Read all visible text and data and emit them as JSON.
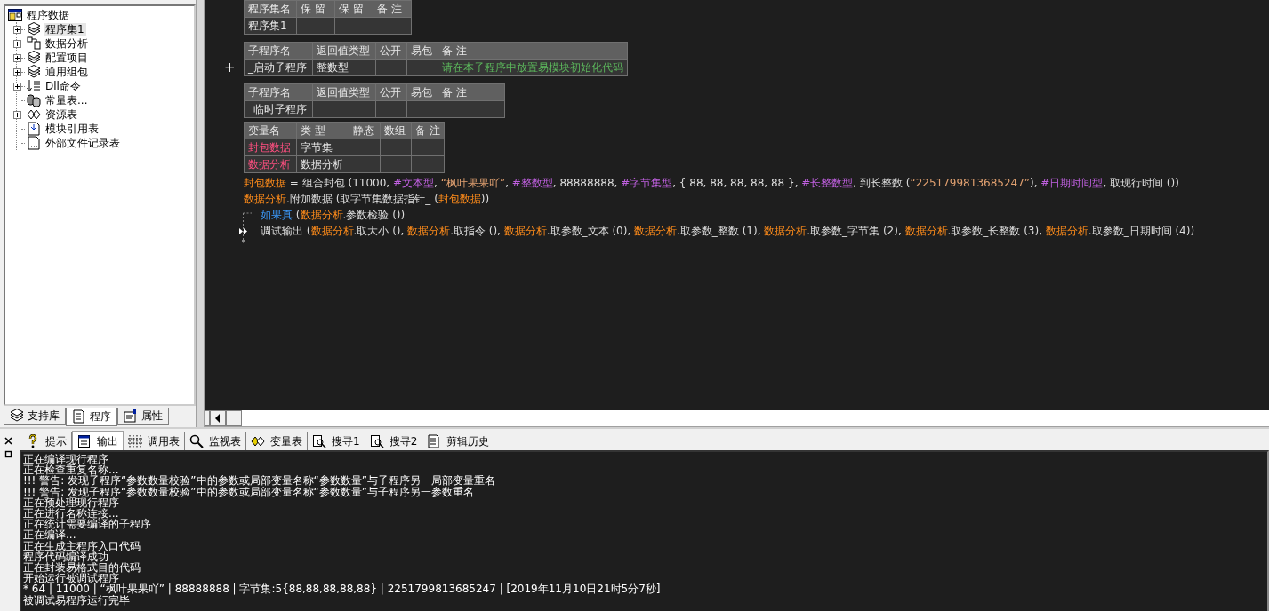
{
  "tree": {
    "root": "程序数据",
    "children": [
      {
        "label": "程序集1",
        "kind": "group",
        "selected": true
      },
      {
        "label": "数据分析",
        "kind": "group",
        "selected": false
      },
      {
        "label": "配置项目",
        "kind": "group",
        "selected": false
      },
      {
        "label": "通用组包",
        "kind": "group",
        "selected": false
      },
      {
        "label": "Dll命令",
        "kind": "group",
        "selected": false
      },
      {
        "label": "常量表...",
        "kind": "leaf",
        "selected": false
      },
      {
        "label": "资源表",
        "kind": "group",
        "selected": false
      },
      {
        "label": "模块引用表",
        "kind": "leaf",
        "selected": false
      },
      {
        "label": "外部文件记录表",
        "kind": "leaf",
        "selected": false
      }
    ]
  },
  "side_tabs": [
    {
      "label": "支持库",
      "selected": false
    },
    {
      "label": "程序",
      "selected": true
    },
    {
      "label": "属性",
      "selected": false
    }
  ],
  "tables": [
    {
      "kind": "assembly",
      "columns": [
        "程序集名",
        "保 留",
        "保 留",
        "备 注"
      ],
      "rows": [
        [
          "程序集1",
          "",
          "",
          ""
        ]
      ]
    },
    {
      "kind": "subprogram",
      "marker": "+",
      "columns": [
        "子程序名",
        "返回值类型",
        "公开",
        "易包",
        "备 注"
      ],
      "rows": [
        [
          "_启动子程序",
          "整数型",
          "",
          "",
          "请在本子程序中放置易模块初始化代码"
        ]
      ]
    },
    {
      "kind": "subprogram",
      "columns": [
        "子程序名",
        "返回值类型",
        "公开",
        "易包",
        "备 注"
      ],
      "rows": [
        [
          "_临时子程序",
          "",
          "",
          "",
          ""
        ]
      ]
    },
    {
      "kind": "variables",
      "columns": [
        "变量名",
        "类 型",
        "静态",
        "数组",
        "备 注"
      ],
      "rows": [
        [
          "封包数据",
          "字节集",
          "",
          "",
          ""
        ],
        [
          "数据分析",
          "数据分析",
          "",
          "",
          ""
        ]
      ]
    }
  ],
  "code": [
    {
      "current": false,
      "segments": [
        {
          "kind": "var",
          "text": "封包数据"
        },
        {
          "kind": "plain",
          "text": " = 组合封包 (11000, "
        },
        {
          "kind": "type",
          "text": "#文本型"
        },
        {
          "kind": "plain",
          "text": ", "
        },
        {
          "kind": "string",
          "text": "“枫叶果果吖”"
        },
        {
          "kind": "plain",
          "text": ", "
        },
        {
          "kind": "type",
          "text": "#整数型"
        },
        {
          "kind": "plain",
          "text": ", 88888888, "
        },
        {
          "kind": "type",
          "text": "#字节集型"
        },
        {
          "kind": "plain",
          "text": ", { 88, 88, 88, 88, 88 }, "
        },
        {
          "kind": "type",
          "text": "#长整数型"
        },
        {
          "kind": "plain",
          "text": ", 到长整数 ("
        },
        {
          "kind": "string",
          "text": "“2251799813685247”"
        },
        {
          "kind": "plain",
          "text": "), "
        },
        {
          "kind": "type",
          "text": "#日期时间型"
        },
        {
          "kind": "plain",
          "text": ", 取现行时间 ())"
        }
      ]
    },
    {
      "current": false,
      "segments": [
        {
          "kind": "var",
          "text": "数据分析"
        },
        {
          "kind": "plain",
          "text": ".附加数据 (取字节集数据指针_ ("
        },
        {
          "kind": "var",
          "text": "封包数据"
        },
        {
          "kind": "plain",
          "text": "))"
        }
      ]
    },
    {
      "current": false,
      "segments": [
        {
          "kind": "flow",
          "text": "如果真"
        },
        {
          "kind": "plain",
          "text": " ("
        },
        {
          "kind": "var",
          "text": "数据分析"
        },
        {
          "kind": "plain",
          "text": ".参数检验 ())"
        }
      ],
      "children": [
        {
          "current": true,
          "segments": [
            {
              "kind": "plain",
              "text": "调试输出 ("
            },
            {
              "kind": "var",
              "text": "数据分析"
            },
            {
              "kind": "plain",
              "text": ".取大小 (), "
            },
            {
              "kind": "var",
              "text": "数据分析"
            },
            {
              "kind": "plain",
              "text": ".取指令 (), "
            },
            {
              "kind": "var",
              "text": "数据分析"
            },
            {
              "kind": "plain",
              "text": ".取参数_文本 (0), "
            },
            {
              "kind": "var",
              "text": "数据分析"
            },
            {
              "kind": "plain",
              "text": ".取参数_整数 (1), "
            },
            {
              "kind": "var",
              "text": "数据分析"
            },
            {
              "kind": "plain",
              "text": ".取参数_字节集 (2), "
            },
            {
              "kind": "var",
              "text": "数据分析"
            },
            {
              "kind": "plain",
              "text": ".取参数_长整数 (3), "
            },
            {
              "kind": "var",
              "text": "数据分析"
            },
            {
              "kind": "plain",
              "text": ".取参数_日期时间 (4))"
            }
          ]
        }
      ]
    }
  ],
  "bottom_tabs": [
    {
      "label": "提示",
      "selected": false
    },
    {
      "label": "输出",
      "selected": true
    },
    {
      "label": "调用表",
      "selected": false
    },
    {
      "label": "监视表",
      "selected": false
    },
    {
      "label": "变量表",
      "selected": false
    },
    {
      "label": "搜寻1",
      "selected": false
    },
    {
      "label": "搜寻2",
      "selected": false
    },
    {
      "label": "剪辑历史",
      "selected": false
    }
  ],
  "output": [
    "正在编译现行程序",
    "正在检查重复名称...",
    "!!! 警告: 发现子程序“参数数量校验”中的参数或局部变量名称“参数数量”与子程序另一局部变量重名",
    "!!! 警告: 发现子程序“参数数量校验”中的参数或局部变量名称“参数数量”与子程序另一参数重名",
    "正在预处理现行程序",
    "正在进行名称连接...",
    "正在统计需要编译的子程序",
    "正在编译...",
    "正在生成主程序入口代码",
    "程序代码编译成功",
    "正在封装易格式目的代码",
    "开始运行被调试程序",
    "* 64 | 11000 | “枫叶果果吖” | 88888888 | 字节集:5{88,88,88,88,88} | 2251799813685247 | [2019年11月10日21时5分7秒]",
    "被调试易程序运行完毕"
  ]
}
